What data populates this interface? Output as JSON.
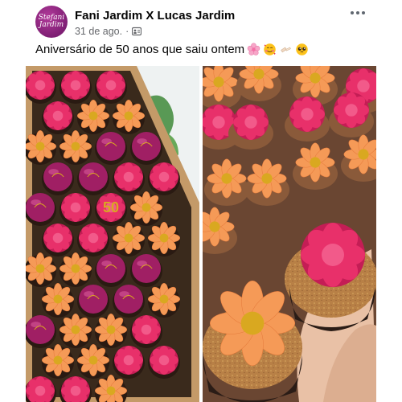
{
  "post": {
    "avatar_text_line1": "Stefani",
    "avatar_text_line2": "Jardim",
    "author": "Fani Jardim X Lucas Jardim",
    "date": "31 de ago.",
    "separator": "·",
    "audience_icon": "friends-icon",
    "caption": "Aniversário de 50 anos que saiu ontem",
    "caption_emojis": [
      "cherry-blossom-emoji",
      "smiling-face-with-hearts-emoji",
      "clinking-glasses-emoji",
      "pleading-face-emoji"
    ],
    "more_icon": "more-horizontal-icon"
  },
  "photos": [
    {
      "id": "left",
      "description_icon": "image-icon",
      "box_number": "50"
    },
    {
      "id": "right",
      "description_icon": "image-icon"
    }
  ],
  "colors": {
    "avatar": "#8a2680",
    "meta_text": "#65676b",
    "rose": "#e8306a",
    "peach_flower": "#f59a57",
    "chocolate_ball": "#a01f64",
    "gold": "#d9a820",
    "gold_glitter": "#b58245"
  }
}
